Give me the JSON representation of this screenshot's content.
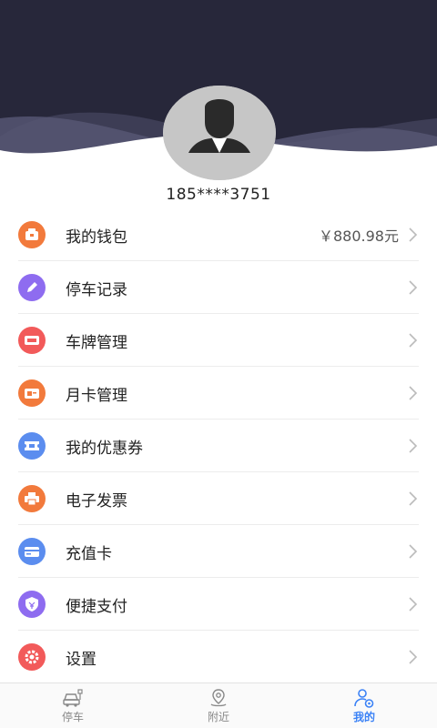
{
  "colors": {
    "header_bg": "#27273a",
    "accent": "#3b82f6"
  },
  "profile": {
    "phone": "185****3751"
  },
  "menu": [
    {
      "label": "我的钱包",
      "value": "￥880.98元",
      "icon": "wallet-icon",
      "color": "#f27a3c"
    },
    {
      "label": "停车记录",
      "value": "",
      "icon": "pencil-icon",
      "color": "#8e6cf0"
    },
    {
      "label": "车牌管理",
      "value": "",
      "icon": "license-plate-icon",
      "color": "#f25a5a"
    },
    {
      "label": "月卡管理",
      "value": "",
      "icon": "card-icon",
      "color": "#f27a3c"
    },
    {
      "label": "我的优惠券",
      "value": "",
      "icon": "coupon-icon",
      "color": "#5b8def"
    },
    {
      "label": "电子发票",
      "value": "",
      "icon": "printer-icon",
      "color": "#f27a3c"
    },
    {
      "label": "充值卡",
      "value": "",
      "icon": "recharge-card-icon",
      "color": "#5b8def"
    },
    {
      "label": "便捷支付",
      "value": "",
      "icon": "shield-pay-icon",
      "color": "#8e6cf0"
    },
    {
      "label": "设置",
      "value": "",
      "icon": "gear-icon",
      "color": "#f25a5a"
    }
  ],
  "tabs": [
    {
      "label": "停车",
      "icon": "car-icon",
      "active": false
    },
    {
      "label": "附近",
      "icon": "location-pin-icon",
      "active": false
    },
    {
      "label": "我的",
      "icon": "user-icon",
      "active": true
    }
  ]
}
